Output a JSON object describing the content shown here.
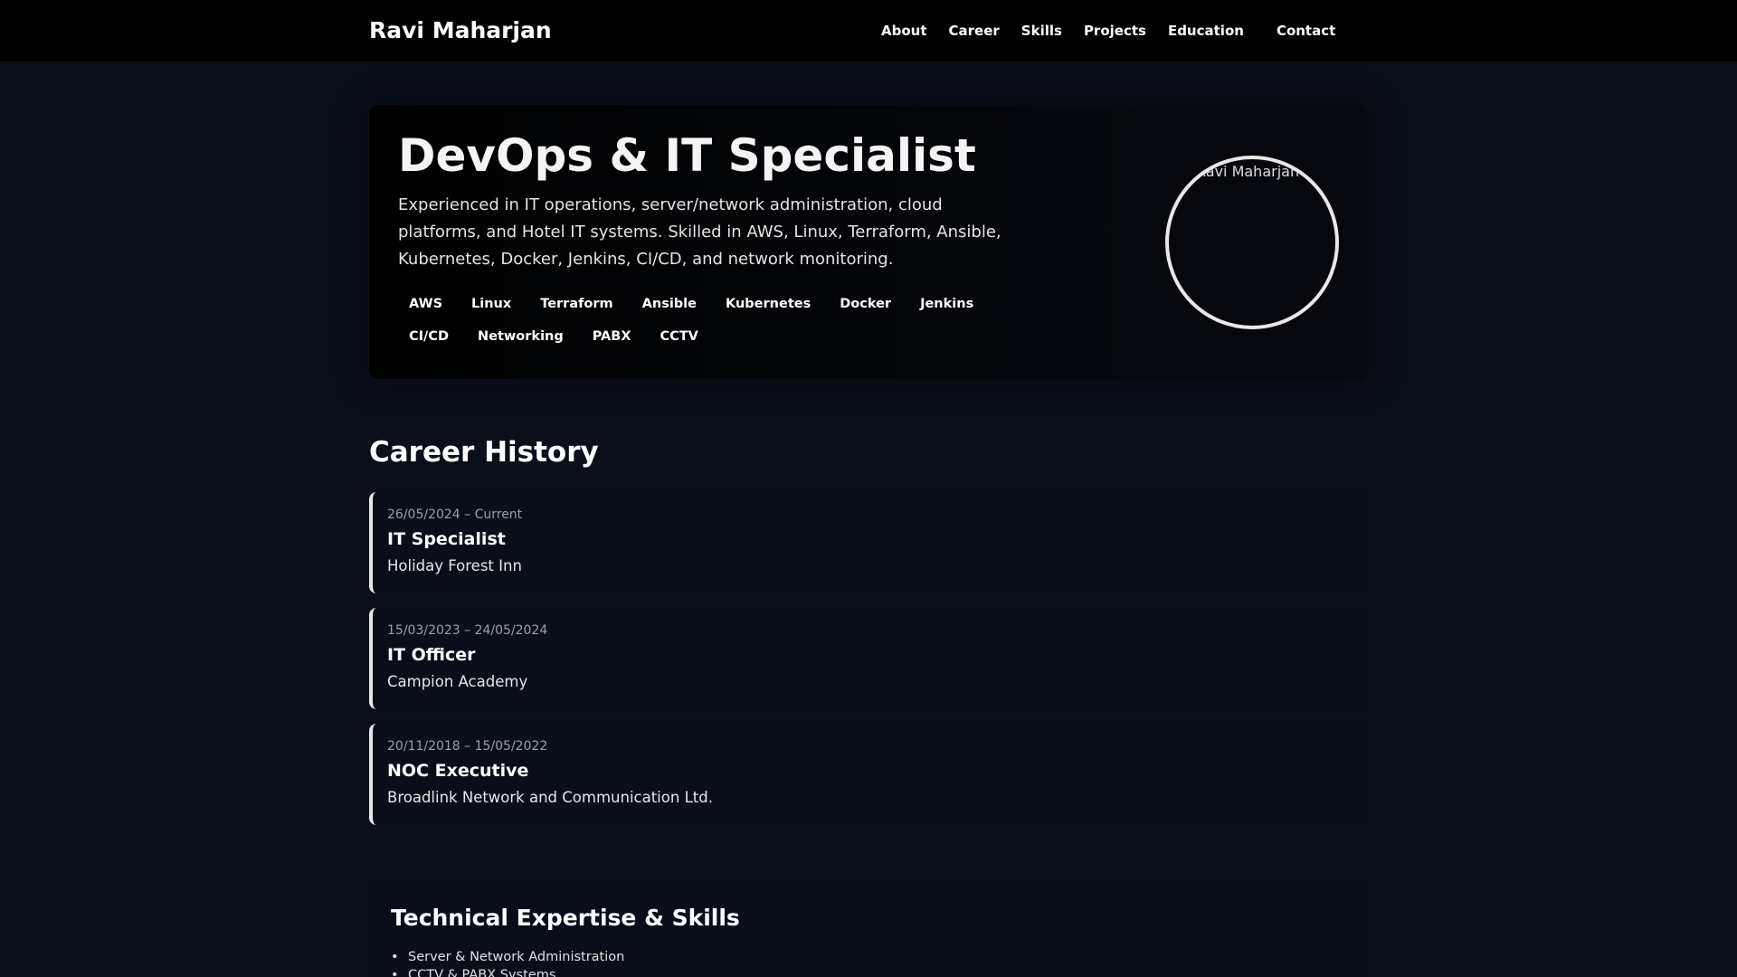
{
  "header": {
    "brand": "Ravi Maharjan",
    "nav": [
      "About",
      "Career",
      "Skills",
      "Projects",
      "Education",
      "Contact"
    ]
  },
  "hero": {
    "title": "DevOps & IT Specialist",
    "description": "Experienced in IT operations, server/network administration, cloud platforms, and Hotel IT systems. Skilled in AWS, Linux, Terraform, Ansible, Kubernetes, Docker, Jenkins, CI/CD, and network monitoring.",
    "tags": [
      "AWS",
      "Linux",
      "Terraform",
      "Ansible",
      "Kubernetes",
      "Docker",
      "Jenkins",
      "CI/CD",
      "Networking",
      "PABX",
      "CCTV"
    ],
    "avatar_alt": "Ravi Maharjan"
  },
  "career": {
    "title": "Career History",
    "jobs": [
      {
        "date": "26/05/2024 – Current",
        "title": "IT Specialist",
        "company": "Holiday Forest Inn"
      },
      {
        "date": "15/03/2023 – 24/05/2024",
        "title": "IT Officer",
        "company": "Campion Academy"
      },
      {
        "date": "20/11/2018 – 15/05/2022",
        "title": "NOC Executive",
        "company": "Broadlink Network and Communication Ltd."
      }
    ]
  },
  "skills": {
    "title": "Technical Expertise & Skills",
    "items": [
      "Server & Network Administration",
      "CCTV & PABX Systems"
    ]
  },
  "colors": {
    "page_background": "#0b0f19",
    "nav_background": "#000000",
    "accent_border": "#e8e8e8"
  }
}
